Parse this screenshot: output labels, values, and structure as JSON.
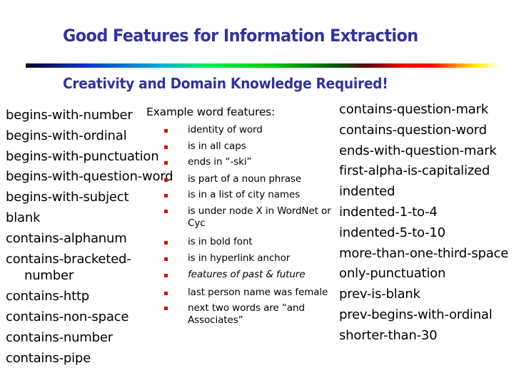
{
  "slide": {
    "title": "Good Features for Information Extraction",
    "subtitle": "Creativity and Domain Knowledge Required!",
    "accent_color": "#333399",
    "bullet_color": "#cc1111"
  },
  "left_features": [
    "begins-with-number",
    "begins-with-ordinal",
    "begins-with-punctuation",
    "begins-with-question-word",
    "begins-with-subject",
    "blank",
    "contains-alphanum",
    "contains-bracketed-",
    "number",
    "contains-http",
    "contains-non-space",
    "contains-number",
    "contains-pipe"
  ],
  "example_word_features": {
    "heading": "Example word features:",
    "items": [
      {
        "line1": "identity of word",
        "line2": ""
      },
      {
        "line1": "is in all caps",
        "line2": ""
      },
      {
        "line1": "ends in “-ski”",
        "line2": ""
      },
      {
        "line1": "is part of a noun phrase",
        "line2": ""
      },
      {
        "line1": "is in a list of city names",
        "line2": ""
      },
      {
        "line1": "is under node X in WordNet or",
        "line2": "Cyc"
      },
      {
        "line1": "is in bold font",
        "line2": ""
      },
      {
        "line1": "is in hyperlink anchor",
        "line2": ""
      },
      {
        "line1": "features of past & future",
        "line2": ""
      },
      {
        "line1": "last person name was female",
        "line2": ""
      },
      {
        "line1": "next two words are “and",
        "line2": "Associates”"
      }
    ]
  },
  "right_features": [
    "contains-question-mark",
    "contains-question-word",
    "ends-with-question-mark",
    "first-alpha-is-capitalized",
    "indented",
    "indented-1-to-4",
    "indented-5-to-10",
    "more-than-one-third-space",
    "only-punctuation",
    "prev-is-blank",
    "prev-begins-with-ordinal",
    "shorter-than-30"
  ]
}
